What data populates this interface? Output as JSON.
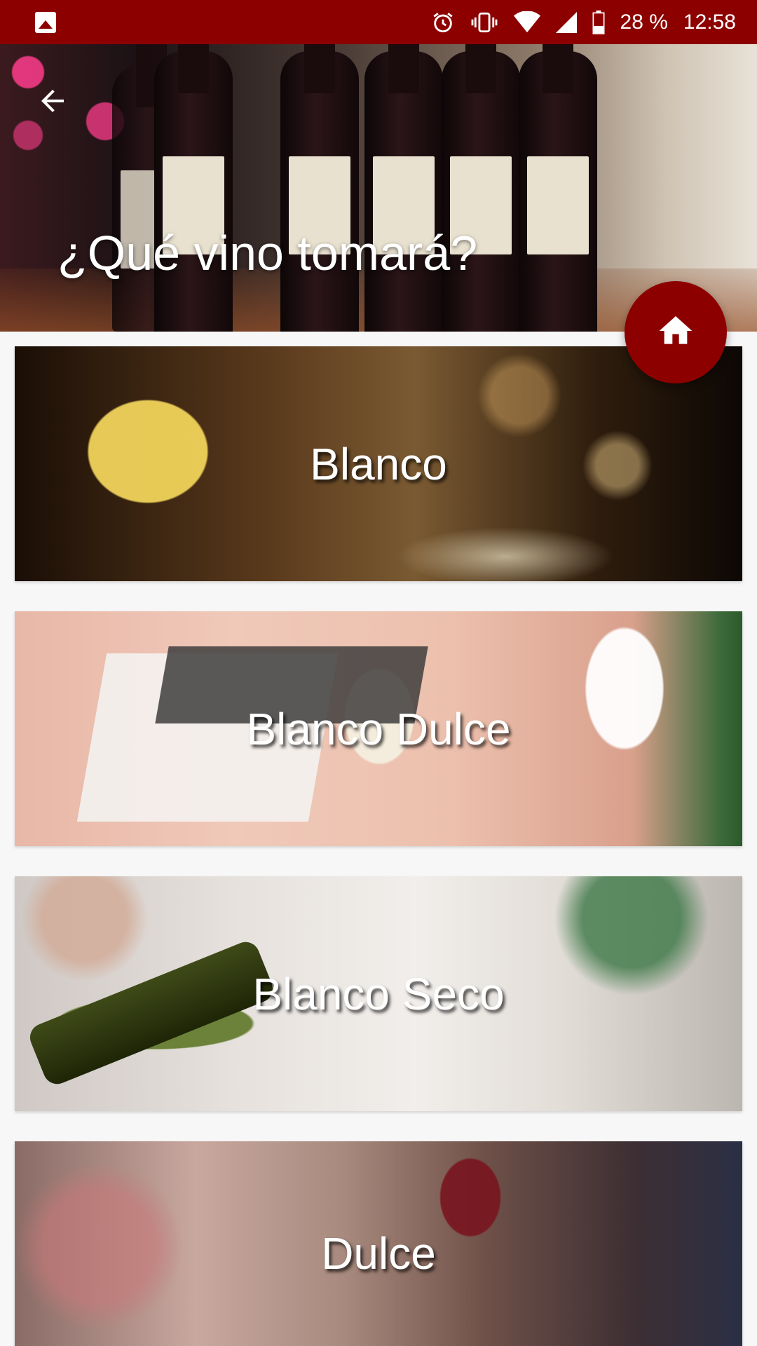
{
  "status_bar": {
    "battery": "28 %",
    "time": "12:58",
    "icons": [
      "gallery-icon",
      "alarm-icon",
      "vibrate-icon",
      "wifi-icon",
      "signal-icon",
      "battery-icon"
    ]
  },
  "header": {
    "title": "¿Qué vino tomará?",
    "back_icon": "arrow-left-icon"
  },
  "fab": {
    "icon": "home-icon",
    "color": "#8d0000"
  },
  "categories": [
    {
      "label": "Blanco"
    },
    {
      "label": "Blanco Dulce"
    },
    {
      "label": "Blanco Seco"
    },
    {
      "label": "Dulce"
    }
  ],
  "colors": {
    "primary": "#8d0000",
    "background": "#f7f7f7"
  }
}
